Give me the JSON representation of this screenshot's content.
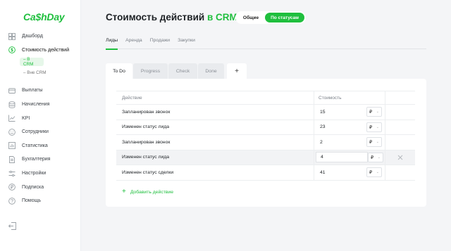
{
  "brand": {
    "logo": "Ca$hDay",
    "accent": "#1fbf3e"
  },
  "sidebar": {
    "items": [
      {
        "label": "Дашборд",
        "icon": "dashboard-icon"
      },
      {
        "label": "Стоимость действий",
        "icon": "dollar-circle-icon",
        "active": true
      },
      {
        "label": "Выплаты",
        "icon": "card-icon"
      },
      {
        "label": "Начисления",
        "icon": "database-icon"
      },
      {
        "label": "KPI",
        "icon": "trend-icon"
      },
      {
        "label": "Сотрудники",
        "icon": "smile-icon"
      },
      {
        "label": "Статистика",
        "icon": "chart-icon"
      },
      {
        "label": "Бухгалтерия",
        "icon": "document-icon"
      },
      {
        "label": "Настройки",
        "icon": "sliders-icon"
      },
      {
        "label": "Подписка",
        "icon": "ruble-icon"
      },
      {
        "label": "Помощь",
        "icon": "help-icon"
      }
    ],
    "subitems": [
      {
        "label": "– В CRM",
        "active": true
      },
      {
        "label": "– Вне CRM"
      }
    ]
  },
  "header": {
    "title_prefix": "Стоимость действий",
    "title_accent": "в CRM",
    "toggle": {
      "option1": "Общие",
      "option2": "По статусам"
    }
  },
  "tabs": [
    "Лиды",
    "Аренда",
    "Продажи",
    "Закупки"
  ],
  "subtabs": [
    "To Do",
    "Progress",
    "Check",
    "Done",
    "+"
  ],
  "table": {
    "columns": [
      "Действие",
      "Стоимость"
    ],
    "rows": [
      {
        "action": "Запланирован звонок",
        "value": "15",
        "currency": "₽"
      },
      {
        "action": "Изменен статус лида",
        "value": "23",
        "currency": "₽"
      },
      {
        "action": "Запланирован звонок",
        "value": "2",
        "currency": "₽"
      },
      {
        "action": "Изменен статус лида",
        "value": "4",
        "currency": "₽",
        "highlighted": true
      },
      {
        "action": "Изменен статус сделки",
        "value": "41",
        "currency": "₽"
      }
    ]
  },
  "add_action": "Добавить действие"
}
